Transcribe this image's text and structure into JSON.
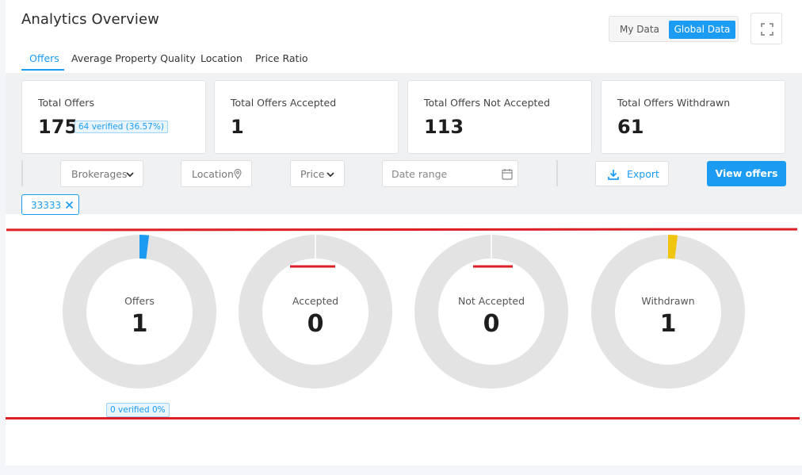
{
  "header": {
    "title": "Analytics Overview",
    "toggle": {
      "my_data": "My Data",
      "global_data": "Global Data",
      "selected": "Global Data"
    }
  },
  "tabs": [
    {
      "label": "Offers",
      "active": true
    },
    {
      "label": "Average Property Quality",
      "active": false
    },
    {
      "label": "Location",
      "active": false
    },
    {
      "label": "Price Ratio",
      "active": false
    }
  ],
  "stats": [
    {
      "label": "Total Offers",
      "value": "175",
      "badge": "64 verified (36.57%)"
    },
    {
      "label": "Total Offers Accepted",
      "value": "1"
    },
    {
      "label": "Total Offers Not Accepted",
      "value": "113"
    },
    {
      "label": "Total Offers Withdrawn",
      "value": "61"
    }
  ],
  "filters": {
    "brokerages": "Brokerages",
    "location": "Location",
    "price": "Price",
    "date_range_placeholder": "Date range",
    "export": "Export",
    "view_offers": "View offers"
  },
  "active_chip": {
    "label": "33333"
  },
  "donuts": [
    {
      "label": "Offers",
      "value": "1",
      "fill_fraction": 0.02,
      "color": "#1b9cf2"
    },
    {
      "label": "Accepted",
      "value": "0",
      "fill_fraction": 0,
      "color": "#1b9cf2"
    },
    {
      "label": "Not Accepted",
      "value": "0",
      "fill_fraction": 0,
      "color": "#1b9cf2"
    },
    {
      "label": "Withdrawn",
      "value": "1",
      "fill_fraction": 0.02,
      "color": "#f1c40f"
    }
  ],
  "offers_verified_badge": "0 verified 0%",
  "colors": {
    "accent": "#1b9cf2",
    "donut_track": "#e3e3e3",
    "withdrawn": "#f1c40f",
    "annotation_red": "#dd1f26"
  }
}
